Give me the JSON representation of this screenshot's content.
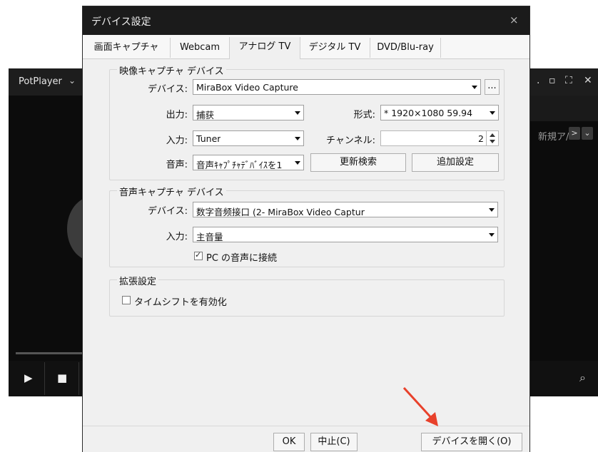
{
  "potplayer": {
    "title": "PotPlayer",
    "title_arrow": "⌄",
    "win_controls": [
      "‥",
      "▫",
      "⛶",
      "✕"
    ],
    "new_tab_label": "新規ア/",
    "nav_next": ">",
    "nav_more": "⌄",
    "play_icon": "play-icon",
    "stop_icon": "stop-icon",
    "search_icon": "search-icon"
  },
  "dialog": {
    "title": "デバイス設定",
    "close": "×",
    "tabs": [
      {
        "label": "画面キャプチャ"
      },
      {
        "label": "Webcam"
      },
      {
        "label": "アナログ TV"
      },
      {
        "label": "デジタル TV"
      },
      {
        "label": "DVD/Blu-ray"
      }
    ],
    "active_tab": "アナログ TV",
    "video_group": {
      "title": "映像キャプチャ デバイス",
      "device_label": "デバイス:",
      "device_value": "MiraBox Video Capture",
      "browse": "...",
      "output_label": "出力:",
      "output_value": "捕获",
      "format_label": "形式:",
      "format_value": "* 1920×1080 59.94",
      "input_label": "入力:",
      "input_value": "Tuner",
      "channel_label": "チャンネル:",
      "channel_value": "2",
      "audio_label": "音声:",
      "audio_value": "音声ｷｬﾌﾟﾁｬﾃﾞﾊﾞｲｽを1",
      "refresh_button": "更新検索",
      "extra_button": "追加設定"
    },
    "audio_group": {
      "title": "音声キャプチャ デバイス",
      "device_label": "デバイス:",
      "device_value": "数字音频接口 (2- MiraBox Video Captur",
      "input_label": "入力:",
      "input_value": "主音量",
      "pc_audio_label": "PC の音声に接続",
      "pc_audio_checked": true
    },
    "ext_group": {
      "title": "拡張設定",
      "timeshift_label": "タイムシフトを有効化",
      "timeshift_checked": false
    },
    "footer": {
      "ok": "OK",
      "cancel": "中止(C)",
      "open_device": "デバイスを開く(O)"
    }
  },
  "colors": {
    "annotation_arrow": "#e8412b",
    "title_bar": "#1b1b1b",
    "dialog_bg": "#f0f0f0"
  }
}
